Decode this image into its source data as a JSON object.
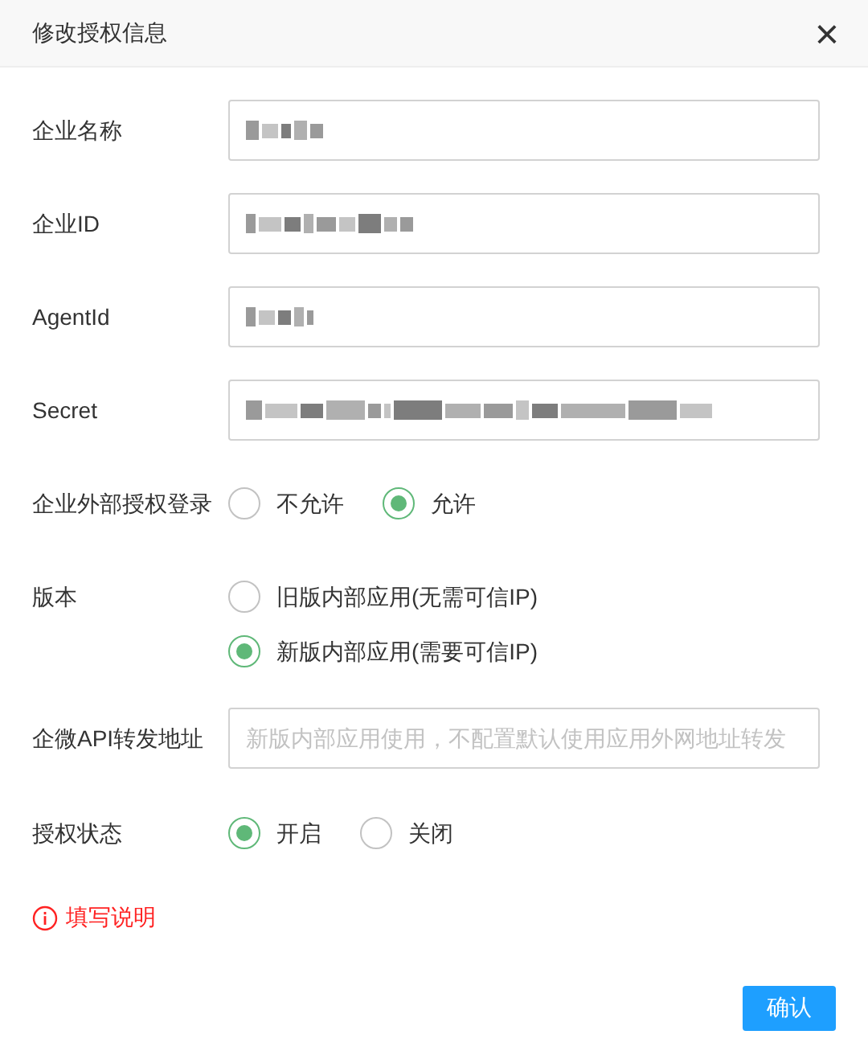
{
  "dialog": {
    "title": "修改授权信息",
    "close": "×"
  },
  "fields": [
    {
      "kind": "input",
      "label": "企业名称",
      "redacted": true
    },
    {
      "kind": "input",
      "label": "企业ID",
      "redacted": true
    },
    {
      "kind": "input",
      "label": "AgentId",
      "redacted": true
    },
    {
      "kind": "input",
      "label": "Secret",
      "redacted": true
    },
    {
      "kind": "radio_inline",
      "label": "企业外部授权登录",
      "options": [
        {
          "label": "不允许",
          "selected": false
        },
        {
          "label": "允许",
          "selected": true
        }
      ]
    },
    {
      "kind": "radio_stacked",
      "label": "版本",
      "options": [
        {
          "label": "旧版内部应用(无需可信IP)",
          "selected": false
        },
        {
          "label": "新版内部应用(需要可信IP)",
          "selected": true
        }
      ]
    },
    {
      "kind": "input",
      "label": "企微API转发地址",
      "placeholder": "新版内部应用使用，不配置默认使用应用外网地址转发"
    },
    {
      "kind": "radio_inline",
      "label": "授权状态",
      "options": [
        {
          "label": "开启",
          "selected": true
        },
        {
          "label": "关闭",
          "selected": false
        }
      ]
    }
  ],
  "help_link": "填写说明",
  "confirm_button": "确认"
}
